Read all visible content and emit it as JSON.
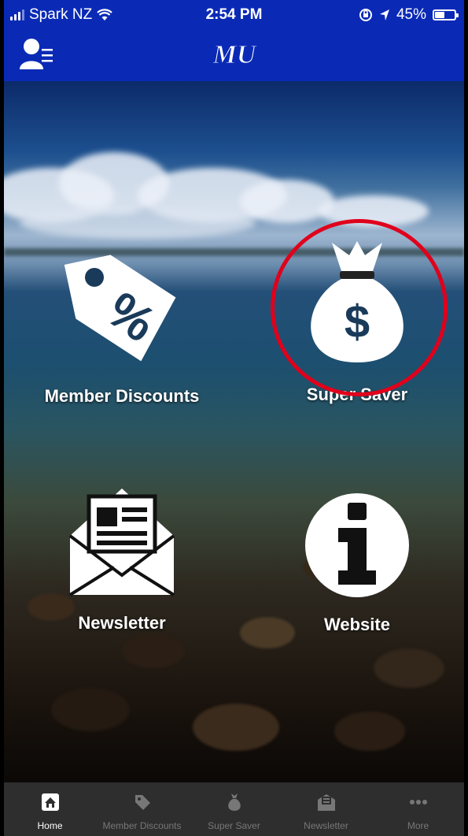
{
  "status_bar": {
    "carrier": "Spark NZ",
    "time": "2:54 PM",
    "battery": "45%",
    "battery_level": 0.45
  },
  "app_bar": {
    "logo": "MU",
    "profile_icon": "profile-menu-icon"
  },
  "tiles": [
    {
      "label": "Member Discounts",
      "icon": "discount-tag-icon"
    },
    {
      "label": "Super Saver",
      "icon": "money-bag-icon",
      "highlighted": true
    },
    {
      "label": "Newsletter",
      "icon": "newsletter-envelope-icon"
    },
    {
      "label": "Website",
      "icon": "info-icon"
    }
  ],
  "tab_bar": {
    "items": [
      {
        "label": "Home",
        "icon": "home-icon",
        "active": true
      },
      {
        "label": "Member Discounts",
        "icon": "tag-icon"
      },
      {
        "label": "Super Saver",
        "icon": "money-bag-icon"
      },
      {
        "label": "Newsletter",
        "icon": "newsletter-icon"
      },
      {
        "label": "More",
        "icon": "more-dots-icon"
      }
    ]
  },
  "colors": {
    "header_blue": "#0a2ab6",
    "tab_bar": "#2e2e2e",
    "highlight_red": "#e0001b"
  }
}
